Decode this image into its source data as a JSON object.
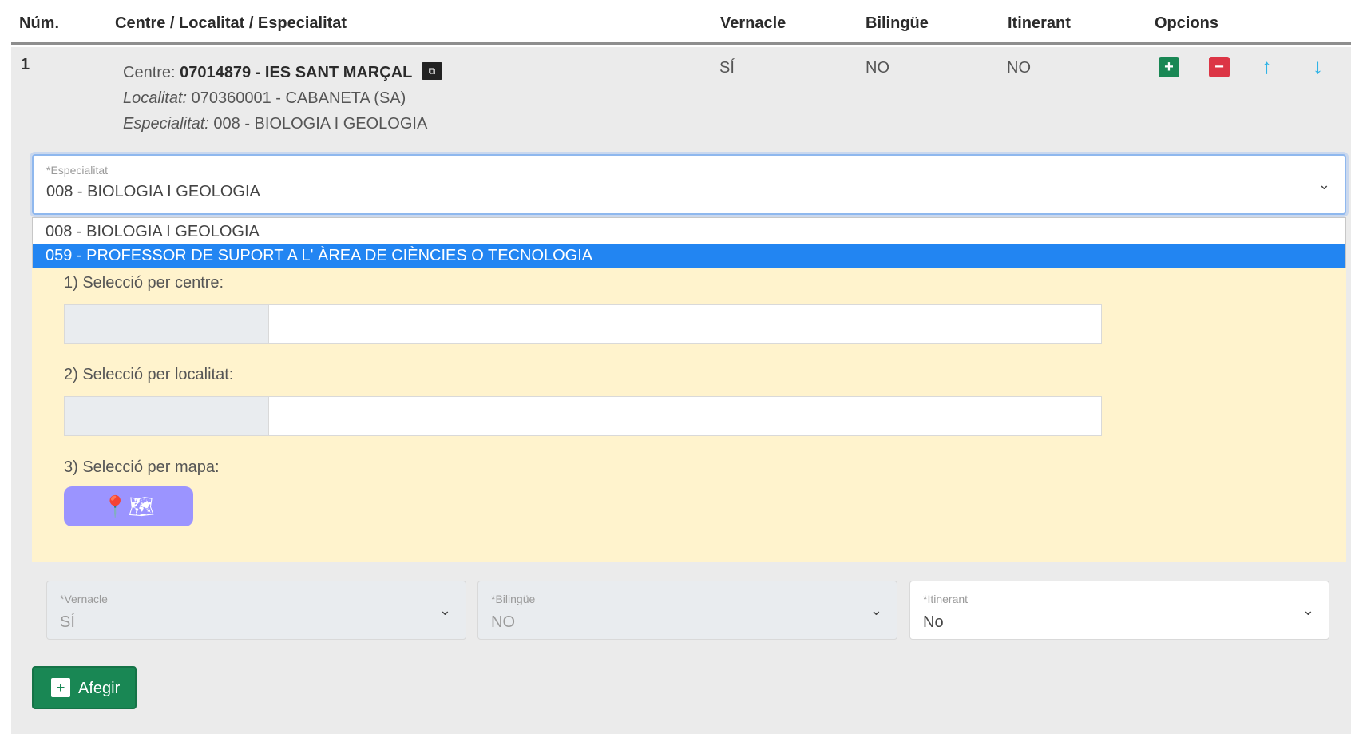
{
  "header": {
    "num": "Núm.",
    "centre": "Centre / Localitat / Especialitat",
    "vernacle": "Vernacle",
    "bilingue": "Bilingüe",
    "itinerant": "Itinerant",
    "opcions": "Opcions"
  },
  "row": {
    "num": "1",
    "centre_label": "Centre:",
    "centre_value": "07014879 - IES SANT MARÇAL",
    "localitat_label": "Localitat:",
    "localitat_value": "070360001 - CABANETA (SA)",
    "especialitat_label": "Especialitat:",
    "especialitat_value": "008 - BIOLOGIA I GEOLOGIA",
    "vernacle": "SÍ",
    "bilingue": "NO",
    "itinerant": "NO"
  },
  "especialitat_select": {
    "label": "*Especialitat",
    "value": "008 - BIOLOGIA I GEOLOGIA",
    "options": [
      "008 - BIOLOGIA I GEOLOGIA",
      "059 - PROFESSOR DE SUPORT A L' ÀREA DE CIÈNCIES O TECNOLOGIA"
    ]
  },
  "panel": {
    "by_centre": "1) Selecció per centre:",
    "by_localitat": "2) Selecció per localitat:",
    "by_map": "3) Selecció per mapa:"
  },
  "bottom": {
    "vernacle_label": "*Vernacle",
    "vernacle_value": "SÍ",
    "bilingue_label": "*Bilingüe",
    "bilingue_value": "NO",
    "itinerant_label": "*Itinerant",
    "itinerant_value": "No",
    "add_label": "Afegir"
  },
  "colors": {
    "accent_green": "#198754",
    "danger_red": "#dc3545",
    "arrow_blue": "#2fb3e6",
    "panel_yellow": "#fff3cd",
    "selected_blue": "#2285f2",
    "map_button": "#9b94ff"
  },
  "icons": {
    "copy": "copy-icon",
    "plus": "plus-icon",
    "minus": "minus-icon",
    "up": "arrow-up-icon",
    "down": "arrow-down-icon",
    "map": "map-icon",
    "chevron": "chevron-down-icon"
  }
}
